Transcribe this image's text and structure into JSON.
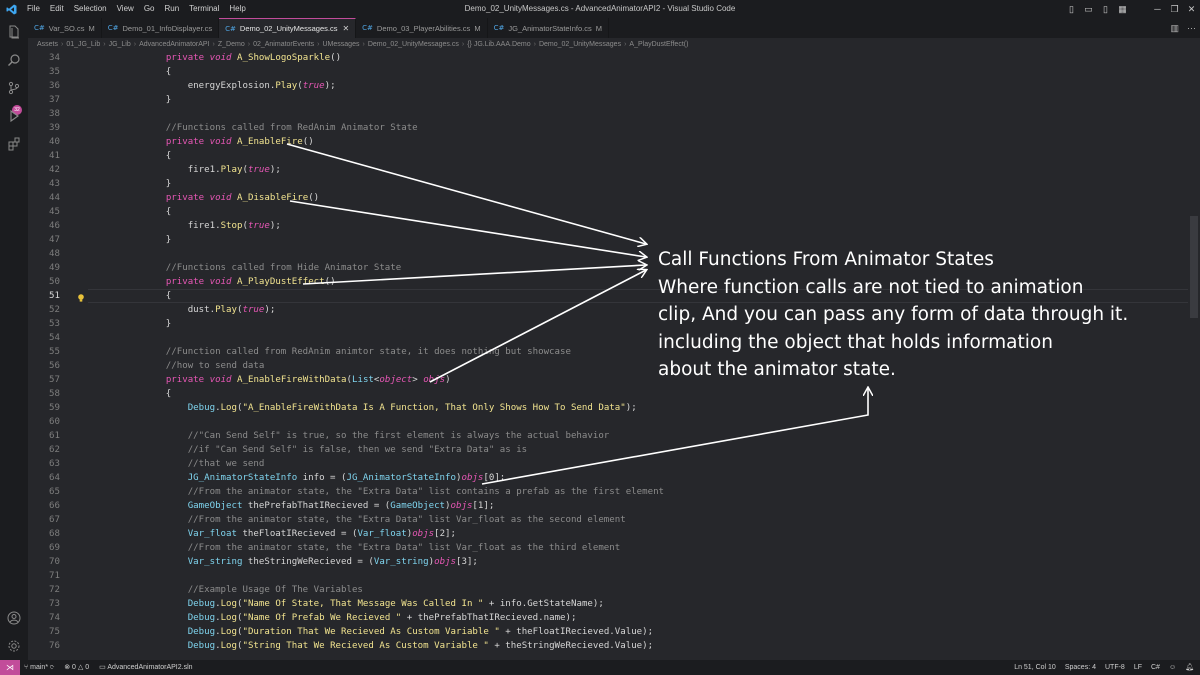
{
  "window": {
    "title": "Demo_02_UnityMessages.cs - AdvancedAnimatorAPI2 - Visual Studio Code",
    "menu": [
      "File",
      "Edit",
      "Selection",
      "View",
      "Go",
      "Run",
      "Terminal",
      "Help"
    ]
  },
  "tabs": [
    {
      "label": "Var_SO.cs",
      "modified": "M",
      "active": false
    },
    {
      "label": "Demo_01_InfoDisplayer.cs",
      "modified": "",
      "active": false
    },
    {
      "label": "Demo_02_UnityMessages.cs",
      "modified": "",
      "active": true
    },
    {
      "label": "Demo_03_PlayerAbilities.cs",
      "modified": "M",
      "active": false
    },
    {
      "label": "JG_AnimatorStateInfo.cs",
      "modified": "M",
      "active": false
    }
  ],
  "tab_icon": "C#",
  "tab_close": "✕",
  "breadcrumb": [
    "Assets",
    "01_JG_Lib",
    "JG_Lib",
    "AdvancedAnimatorAPI",
    "Z_Demo",
    "02_AnimatorEvents",
    "UMessages",
    "Demo_02_UnityMessages.cs",
    "{} JG.Lib.AAA.Demo",
    "Demo_02_UnityMessages",
    "A_PlayDustEffect()"
  ],
  "activity_badge": "32",
  "code": {
    "current_line": "51",
    "lines": [
      {
        "n": "34",
        "t": "        private void A_ShowLogoSparkle()"
      },
      {
        "n": "35",
        "t": "        {"
      },
      {
        "n": "36",
        "t": "            energyExplosion.Play(true);"
      },
      {
        "n": "37",
        "t": "        }"
      },
      {
        "n": "38",
        "t": ""
      },
      {
        "n": "39",
        "t": "        //Functions called from RedAnim Animator State"
      },
      {
        "n": "40",
        "t": "        private void A_EnableFire()"
      },
      {
        "n": "41",
        "t": "        {"
      },
      {
        "n": "42",
        "t": "            fire1.Play(true);"
      },
      {
        "n": "43",
        "t": "        }"
      },
      {
        "n": "44",
        "t": "        private void A_DisableFire()"
      },
      {
        "n": "45",
        "t": "        {"
      },
      {
        "n": "46",
        "t": "            fire1.Stop(true);"
      },
      {
        "n": "47",
        "t": "        }"
      },
      {
        "n": "48",
        "t": ""
      },
      {
        "n": "49",
        "t": "        //Functions called from Hide Animator State"
      },
      {
        "n": "50",
        "t": "        private void A_PlayDustEffect()"
      },
      {
        "n": "51",
        "t": "        {"
      },
      {
        "n": "52",
        "t": "            dust.Play(true);"
      },
      {
        "n": "53",
        "t": "        }"
      },
      {
        "n": "54",
        "t": ""
      },
      {
        "n": "55",
        "t": "        //Function called from RedAnim animtor state, it does nothing but showcase"
      },
      {
        "n": "56",
        "t": "        //how to send data"
      },
      {
        "n": "57",
        "t": "        private void A_EnableFireWithData(List<object> objs)"
      },
      {
        "n": "58",
        "t": "        {"
      },
      {
        "n": "59",
        "t": "            Debug.Log(\"A_EnableFireWithData Is A Function, That Only Shows How To Send Data\");"
      },
      {
        "n": "60",
        "t": ""
      },
      {
        "n": "61",
        "t": "            //\"Can Send Self\" is true, so the first element is always the actual behavior"
      },
      {
        "n": "62",
        "t": "            //if \"Can Send Self\" is false, then we send \"Extra Data\" as is"
      },
      {
        "n": "63",
        "t": "            //that we send"
      },
      {
        "n": "64",
        "t": "            JG_AnimatorStateInfo info = (JG_AnimatorStateInfo)objs[0];"
      },
      {
        "n": "65",
        "t": "            //From the animator state, the \"Extra Data\" list contains a prefab as the first element"
      },
      {
        "n": "66",
        "t": "            GameObject thePrefabThatIRecieved = (GameObject)objs[1];"
      },
      {
        "n": "67",
        "t": "            //From the animator state, the \"Extra Data\" list Var_float as the second element"
      },
      {
        "n": "68",
        "t": "            Var_float theFloatIRecieved = (Var_float)objs[2];"
      },
      {
        "n": "69",
        "t": "            //From the animator state, the \"Extra Data\" list Var_float as the third element"
      },
      {
        "n": "70",
        "t": "            Var_string theStringWeRecieved = (Var_string)objs[3];"
      },
      {
        "n": "71",
        "t": ""
      },
      {
        "n": "72",
        "t": "            //Example Usage Of The Variables"
      },
      {
        "n": "73",
        "t": "            Debug.Log(\"Name Of State, That Message Was Called In \" + info.GetStateName);"
      },
      {
        "n": "74",
        "t": "            Debug.Log(\"Name Of Prefab We Recieved \" + thePrefabThatIRecieved.name);"
      },
      {
        "n": "75",
        "t": "            Debug.Log(\"Duration That We Recieved As Custom Variable \" + theFloatIRecieved.Value);"
      },
      {
        "n": "76",
        "t": "            Debug.Log(\"String That We Recieved As Custom Variable \" + theStringWeRecieved.Value);"
      }
    ]
  },
  "annotation": [
    "Call Functions From Animator States",
    "Where function calls are not tied to animation",
    "clip, And you can pass any form of data through it.",
    "including the object that holds information",
    "about the animator state."
  ],
  "status": {
    "branch": "main*",
    "errors": "0",
    "warnings": "0",
    "solution": "AdvancedAnimatorAPI2.sln",
    "position": "Ln 51, Col 10",
    "spaces": "Spaces: 4",
    "encoding": "UTF-8",
    "eol": "LF",
    "language": "C#"
  },
  "colors": {
    "accent": "#c24c9a",
    "keyword": "#e657b5",
    "function": "#f1e38f",
    "comment": "#8c8c8c",
    "background": "#26272b"
  },
  "icons": [
    "vscode-logo-icon",
    "explorer-icon",
    "search-icon",
    "source-control-icon",
    "run-debug-icon",
    "extensions-icon",
    "account-icon",
    "settings-gear-icon",
    "lightbulb-icon",
    "split-editor-icon",
    "more-actions-icon",
    "branch-icon",
    "sync-icon",
    "error-icon",
    "warning-icon",
    "folder-icon",
    "feedback-icon",
    "bell-icon"
  ]
}
